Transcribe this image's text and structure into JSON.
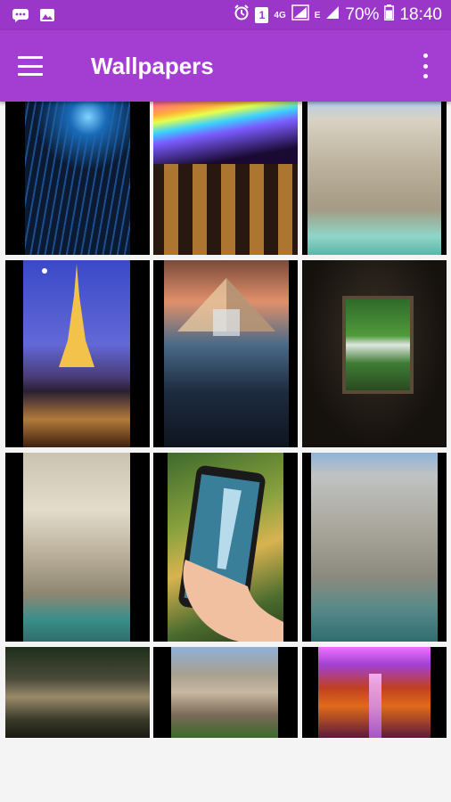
{
  "status_bar": {
    "battery": "70%",
    "time": "18:40",
    "network_4g": "4G",
    "network_e": "E",
    "sim": "1"
  },
  "app_bar": {
    "title": "Wallpapers",
    "menu_icon": "hamburger-menu-icon",
    "more_icon": "more-vert-icon"
  },
  "colors": {
    "status_bar": "#9a36c8",
    "app_bar": "#a43ed3",
    "background": "#f4f4f4"
  },
  "wallpapers": [
    {
      "subject": "blue light fiber fountain"
    },
    {
      "subject": "neon light colonnade"
    },
    {
      "subject": "trevi fountain"
    },
    {
      "subject": "eiffel tower at night"
    },
    {
      "subject": "louvre pyramid fountain"
    },
    {
      "subject": "waterfall in jungle frame"
    },
    {
      "subject": "fountain statue close-up"
    },
    {
      "subject": "waterfall on phone in hand"
    },
    {
      "subject": "trevi fountain facade"
    },
    {
      "subject": "forest waterfall"
    },
    {
      "subject": "city skyscrapers"
    },
    {
      "subject": "purple waterfall autumn"
    }
  ]
}
